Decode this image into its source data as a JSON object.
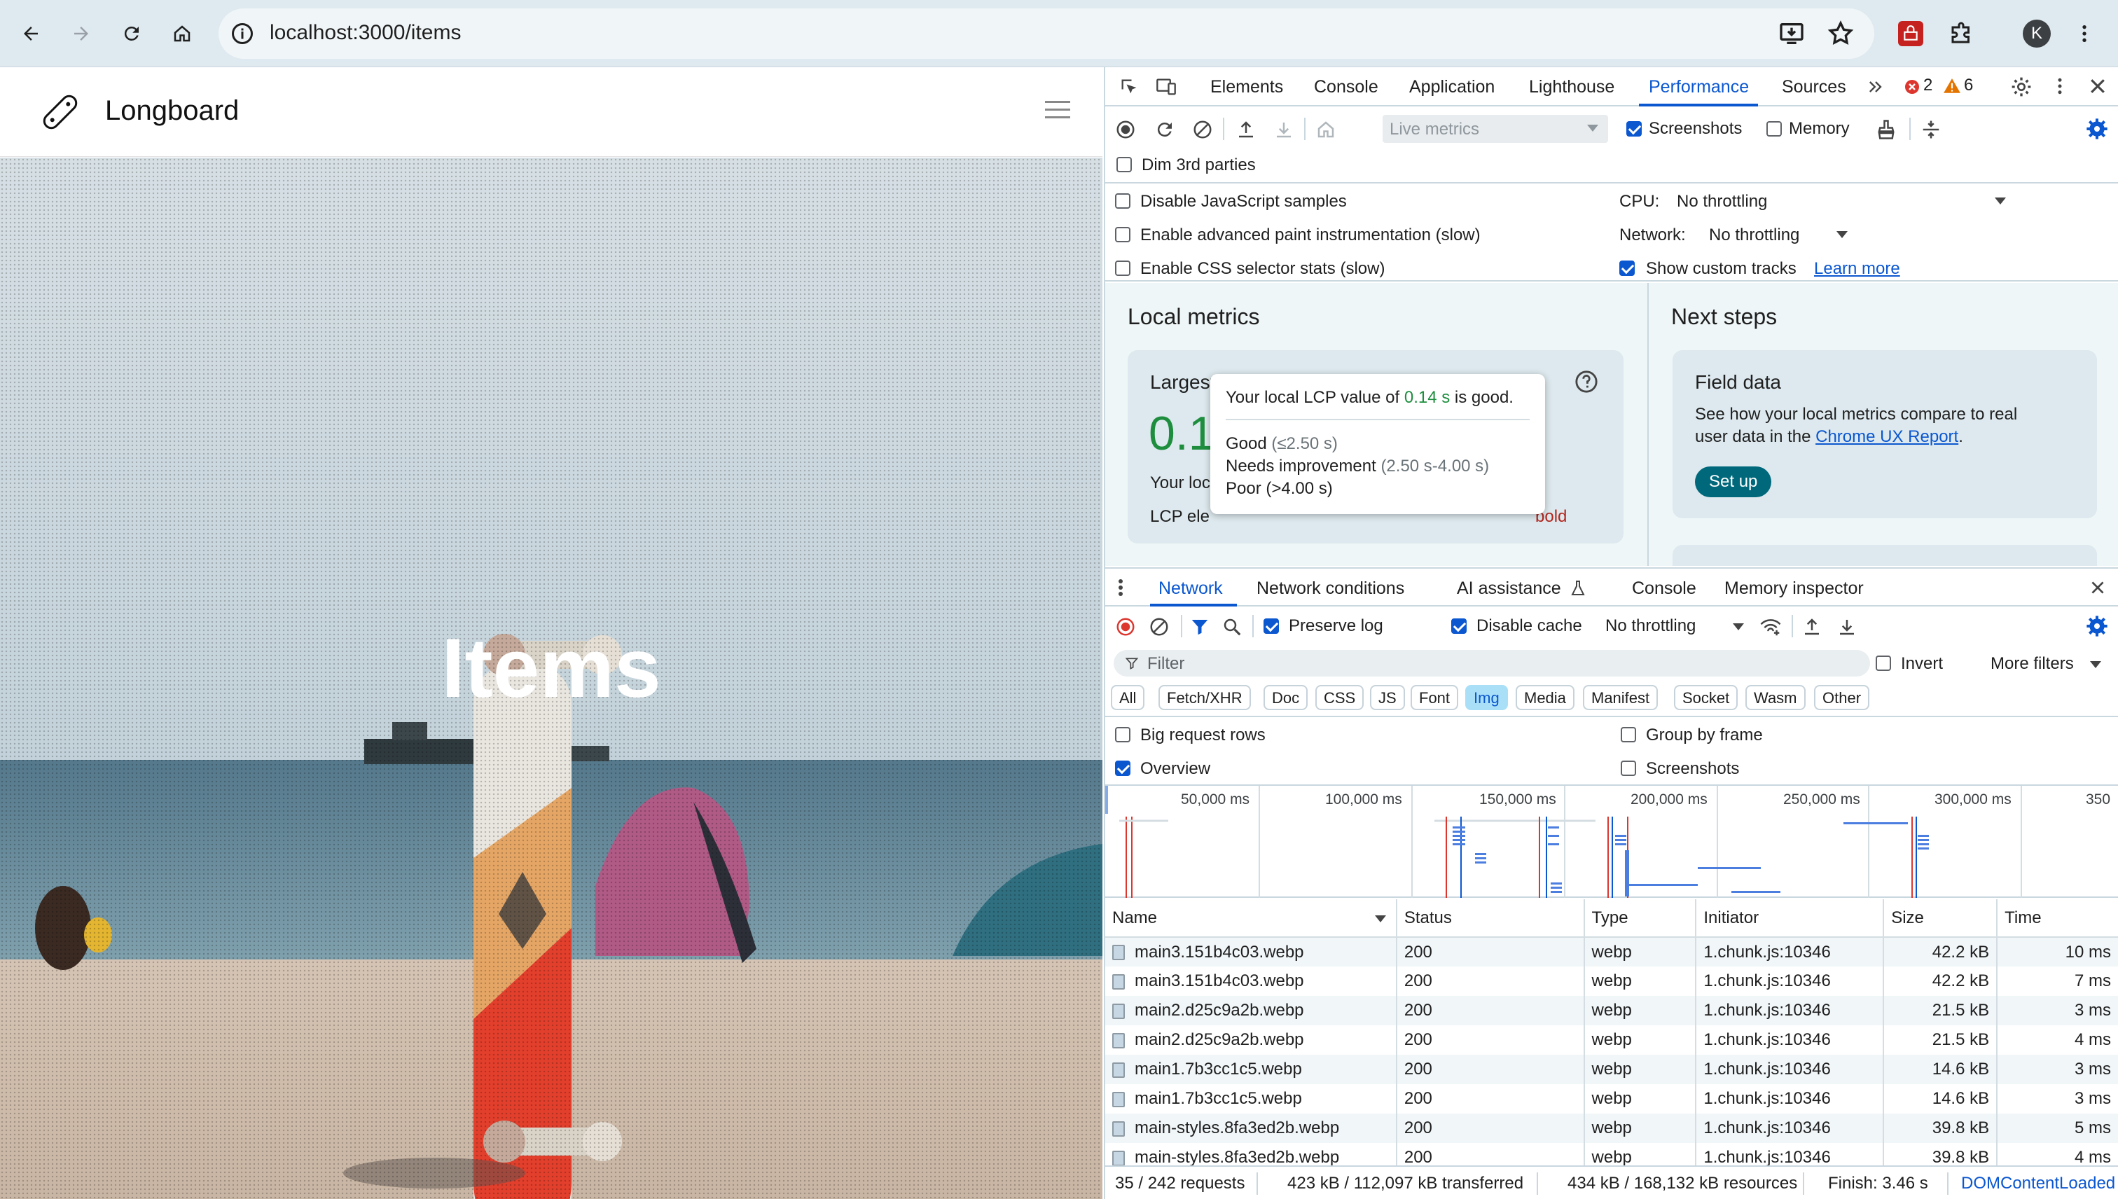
{
  "browser": {
    "url": "localhost:3000/items",
    "profile_initial": "K",
    "icons": [
      "back-icon",
      "forward-icon",
      "reload-icon",
      "home-icon",
      "site-info-icon",
      "install-app-icon",
      "bookmark-star-icon",
      "extension-icon",
      "puzzle-icon",
      "profile-avatar",
      "kebab-menu-icon"
    ]
  },
  "page": {
    "brand": "Longboard",
    "hero_title": "Items"
  },
  "devtools": {
    "tabs": [
      "Elements",
      "Console",
      "Application",
      "Lighthouse",
      "Performance",
      "Sources"
    ],
    "active_tab": "Performance",
    "error_count": "2",
    "warning_count": "6",
    "perf_toolbar": {
      "metrics_select": "Live metrics",
      "screenshots_label": "Screenshots",
      "memory_label": "Memory",
      "dim_label": "Dim 3rd parties"
    },
    "perf_settings": {
      "disable_js": "Disable JavaScript samples",
      "paint": "Enable advanced paint instrumentation (slow)",
      "css_stats": "Enable CSS selector stats (slow)",
      "cpu_label": "CPU:",
      "cpu_value": "No throttling",
      "network_label": "Network:",
      "network_value": "No throttling",
      "custom_tracks": "Show custom tracks",
      "learn_more": "Learn more"
    },
    "local_metrics": {
      "heading": "Local metrics",
      "card_title": "Largest Contentful Paint (LCP)",
      "value": "0.14 s",
      "your_local_partial": "Your loc",
      "lcp_el_partial": "LCP ele",
      "bold_partial": "bold",
      "tooltip": {
        "prefix": "Your local LCP value of",
        "value": "0.14 s",
        "suffix": "is good.",
        "good_label": "Good",
        "good_range": "(≤2.50 s)",
        "ni_label": "Needs improvement",
        "ni_range": "(2.50 s-4.00 s)",
        "poor_partial": "Poor (>4.00 s)"
      }
    },
    "next_steps": {
      "heading": "Next steps",
      "card_title": "Field data",
      "body_1": "See how your local metrics compare to real",
      "body_2_prefix": "user data in the",
      "body_link": "Chrome UX Report",
      "body_2_suffix": ".",
      "button": "Set up"
    },
    "drawer": {
      "tabs": [
        "Network",
        "Network conditions",
        "AI assistance",
        "Console",
        "Memory inspector"
      ],
      "active_tab": "Network"
    },
    "network": {
      "preserve_log": "Preserve log",
      "disable_cache": "Disable cache",
      "throttling": "No throttling",
      "filter_placeholder": "Filter",
      "invert": "Invert",
      "more_filters": "More filters",
      "type_filters": [
        "All",
        "Fetch/XHR",
        "Doc",
        "CSS",
        "JS",
        "Font",
        "Img",
        "Media",
        "Manifest",
        "Socket",
        "Wasm",
        "Other"
      ],
      "active_filter": "Img",
      "big_rows": "Big request rows",
      "group_frame": "Group by frame",
      "overview": "Overview",
      "screenshots": "Screenshots",
      "timeline_ticks": [
        "50,000 ms",
        "100,000 ms",
        "150,000 ms",
        "200,000 ms",
        "250,000 ms",
        "300,000 ms",
        "350"
      ],
      "columns": [
        "Name",
        "Status",
        "Type",
        "Initiator",
        "Size",
        "Time"
      ],
      "rows": [
        {
          "name": "main3.151b4c03.webp",
          "status": "200",
          "type": "webp",
          "initiator": "1.chunk.js:10346",
          "size": "42.2 kB",
          "time": "10 ms"
        },
        {
          "name": "main3.151b4c03.webp",
          "status": "200",
          "type": "webp",
          "initiator": "1.chunk.js:10346",
          "size": "42.2 kB",
          "time": "7 ms"
        },
        {
          "name": "main2.d25c9a2b.webp",
          "status": "200",
          "type": "webp",
          "initiator": "1.chunk.js:10346",
          "size": "21.5 kB",
          "time": "3 ms"
        },
        {
          "name": "main2.d25c9a2b.webp",
          "status": "200",
          "type": "webp",
          "initiator": "1.chunk.js:10346",
          "size": "21.5 kB",
          "time": "4 ms"
        },
        {
          "name": "main1.7b3cc1c5.webp",
          "status": "200",
          "type": "webp",
          "initiator": "1.chunk.js:10346",
          "size": "14.6 kB",
          "time": "3 ms"
        },
        {
          "name": "main1.7b3cc1c5.webp",
          "status": "200",
          "type": "webp",
          "initiator": "1.chunk.js:10346",
          "size": "14.6 kB",
          "time": "3 ms"
        },
        {
          "name": "main-styles.8fa3ed2b.webp",
          "status": "200",
          "type": "webp",
          "initiator": "1.chunk.js:10346",
          "size": "39.8 kB",
          "time": "5 ms"
        },
        {
          "name": "main-styles.8fa3ed2b.webp",
          "status": "200",
          "type": "webp",
          "initiator": "1.chunk.js:10346",
          "size": "39.8 kB",
          "time": "4 ms"
        }
      ],
      "status_bar": {
        "requests": "35 / 242 requests",
        "transferred": "423 kB / 112,097 kB transferred",
        "resources": "434 kB / 168,132 kB resources",
        "finish": "Finish: 3.46 s",
        "dcl": "DOMContentLoaded"
      }
    }
  }
}
